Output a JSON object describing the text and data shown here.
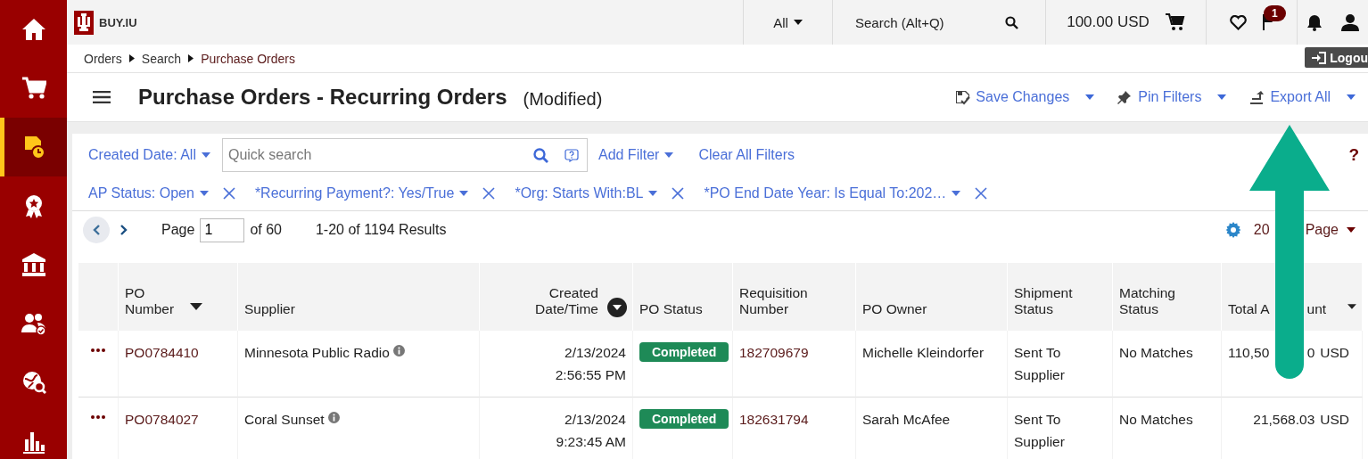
{
  "sidebar": {
    "items": [
      {
        "selected": false
      },
      {
        "selected": false
      },
      {
        "selected": true
      },
      {
        "selected": false
      },
      {
        "selected": false
      },
      {
        "selected": false
      },
      {
        "selected": false
      },
      {
        "selected": false
      }
    ]
  },
  "topbar": {
    "logo_text": "BUY.IU",
    "scope": "All",
    "search": {
      "placeholder": "Search (Alt+Q)"
    },
    "cart_total": "100.00 USD",
    "flag_badge": "1"
  },
  "breadcrumb": [
    "Orders",
    "Search",
    "Purchase Orders"
  ],
  "logout": "Logou",
  "header": {
    "title": "Purchase Orders - Recurring Orders",
    "subtitle": "(Modified)",
    "actions": [
      "Save Changes",
      "Pin Filters",
      "Export All"
    ]
  },
  "filters": {
    "created_date": "Created Date: All",
    "quick_search": {
      "placeholder": "Quick search"
    },
    "add_filter": "Add Filter",
    "clear_all": "Clear All Filters",
    "help": "?",
    "chips": [
      "AP Status: Open",
      "*Recurring Payment?: Yes/True",
      "*Org: Starts With:BL",
      "*PO End Date Year: Is Equal To:202…"
    ]
  },
  "pagination": {
    "page_label": "Page",
    "page": "1",
    "of_pages": "of 60",
    "results": "1-20 of 1194 Results",
    "per_page": [
      "20",
      "Page"
    ]
  },
  "table": {
    "columns": [
      {
        "lines": [
          "PO",
          "Number"
        ],
        "sortable": true,
        "sorted": false
      },
      {
        "lines": [
          "Supplier"
        ],
        "sortable": false
      },
      {
        "lines": [
          "Created",
          "Date/Time"
        ],
        "sortable": true,
        "sorted": true
      },
      {
        "lines": [
          "PO Status"
        ],
        "sortable": false
      },
      {
        "lines": [
          "Requisition",
          "Number"
        ],
        "sortable": false
      },
      {
        "lines": [
          "PO Owner"
        ],
        "sortable": false
      },
      {
        "lines": [
          "Shipment",
          "Status"
        ],
        "sortable": false
      },
      {
        "lines": [
          "Matching",
          "Status"
        ],
        "sortable": false
      },
      {
        "parts": [
          "Total A",
          "unt"
        ],
        "sortable": true,
        "sorted": false
      }
    ],
    "rows": [
      {
        "po_number": "PO0784410",
        "supplier": "Minnesota Public Radio",
        "date": "2/13/2024",
        "time": "2:56:55 PM",
        "status": "Completed",
        "requisition": "182709679",
        "owner": "Michelle Kleindorfer",
        "shipment": "Sent To Supplier",
        "matching": "No Matches",
        "amount": [
          "110,50",
          "0"
        ],
        "currency": "USD"
      },
      {
        "po_number": "PO0784027",
        "supplier": "Coral Sunset",
        "date": "2/13/2024",
        "time": "9:23:45 AM",
        "status": "Completed",
        "requisition": "182631794",
        "owner": "Sarah McAfee",
        "shipment": "Sent To Supplier",
        "matching": "No Matches",
        "amount": [
          "21,568.03"
        ],
        "currency": "USD"
      }
    ]
  }
}
